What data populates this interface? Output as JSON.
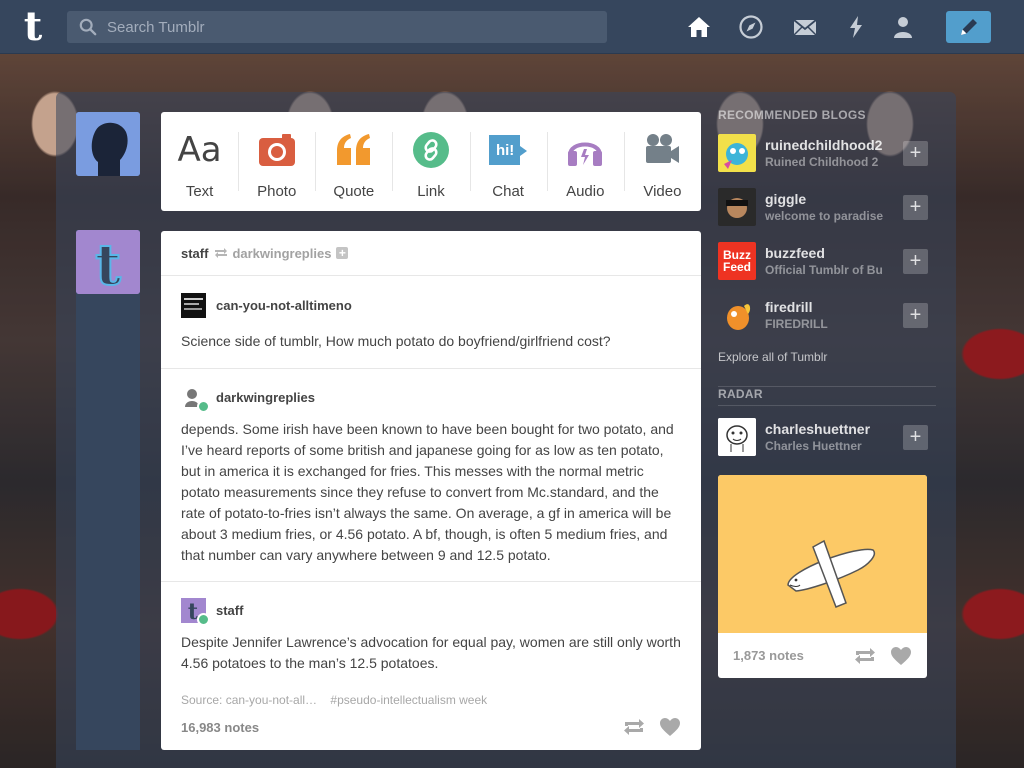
{
  "colors": {
    "navy": "#36465d",
    "accent_blue": "#529ecc",
    "photo_red": "#d95e40",
    "quote_orange": "#f2992e",
    "link_green": "#56bc8a",
    "chat_blue": "#529ecc",
    "audio_purple": "#a77dc2",
    "video_grey": "#748089"
  },
  "search": {
    "placeholder": "Search Tumblr"
  },
  "nav": [
    "home-icon",
    "explore-icon",
    "inbox-icon",
    "activity-icon",
    "account-icon",
    "compose-icon"
  ],
  "post_types": [
    {
      "label": "Text",
      "icon": "text-icon",
      "glyph": "Aa"
    },
    {
      "label": "Photo",
      "icon": "camera-icon"
    },
    {
      "label": "Quote",
      "icon": "quote-icon",
      "glyph": "“"
    },
    {
      "label": "Link",
      "icon": "link-icon"
    },
    {
      "label": "Chat",
      "icon": "chat-icon",
      "glyph": "hi!"
    },
    {
      "label": "Audio",
      "icon": "headphones-icon"
    },
    {
      "label": "Video",
      "icon": "video-camera-icon"
    }
  ],
  "post": {
    "author": "staff",
    "reblogged_from": "darkwingreplies",
    "trail": [
      {
        "user": "can-you-not-alltimeno",
        "text": "Science side of tumblr, How much potato do boyfriend/girlfriend cost?"
      },
      {
        "user": "darkwingreplies",
        "text": "depends. Some irish have been known to have been bought for two potato, and I’ve heard reports of some british and japanese going for as low as ten potato, but in america it is exchanged for fries. This messes with the normal metric potato measurements since they refuse to convert from Mc.standard, and the rate of potato-to-fries isn’t always the same. On average, a gf in america will be about 3 medium fries, or 4.56 potato. A bf, though, is often 5 medium fries, and that number can vary anywhere between 9 and 12.5 potato."
      },
      {
        "user": "staff",
        "text": "Despite Jennifer Lawrence’s advocation for equal pay, women are still only worth 4.56 potatoes to the man’s 12.5 potatoes."
      }
    ],
    "source": "Source: can-you-not-all…",
    "tag": "#pseudo-intellectualism week",
    "notes": "16,983 notes"
  },
  "sidebar": {
    "recommended_title": "RECOMMENDED BLOGS",
    "blogs": [
      {
        "name": "ruinedchildhood2",
        "sub": "Ruined Childhood 2"
      },
      {
        "name": "giggle",
        "sub": "welcome to paradise"
      },
      {
        "name": "buzzfeed",
        "sub": "Official Tumblr of Bu"
      },
      {
        "name": "firedrill",
        "sub": "FIREDRILL"
      }
    ],
    "buzzfeed_logo": "Buzz Feed",
    "explore": "Explore all of Tumblr",
    "radar_title": "RADAR",
    "radar_blog": {
      "name": "charleshuettner",
      "sub": "Charles Huettner"
    },
    "radar_notes": "1,873 notes"
  }
}
